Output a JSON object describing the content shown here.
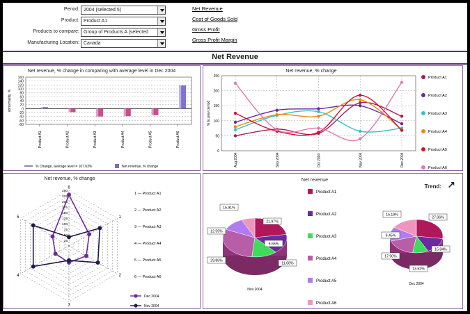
{
  "filters": [
    {
      "label": "Period:",
      "value": "2004 (selected 5)"
    },
    {
      "label": "Product:",
      "value": "Product A1"
    },
    {
      "label": "Products to compare:",
      "value": "Group of Products A (selected"
    },
    {
      "label": "Manufacturing Location:",
      "value": "Canada"
    }
  ],
  "links": [
    "Net Revenue",
    "Cost of Goods Sold",
    "Gross Profit",
    "Gross Profit Margin"
  ],
  "main_title": "Net Revenue",
  "colors": {
    "purple_dark": "#5b2d7a",
    "p1": "#b0185a",
    "p2": "#6a2aa0",
    "p3": "#2fc3c9",
    "p4": "#e78b12",
    "p5": "#d41030",
    "p6": "#e07ab0"
  },
  "chart_data": [
    {
      "type": "bar",
      "title": "Net revenue, % change in comparing with average level in Dec 2004",
      "ylabel": "abnormality, %",
      "categories": [
        "Product A1",
        "Product A2",
        "Product A3",
        "Product A4",
        "Product A5",
        "Product A6"
      ],
      "ylim": [
        -80,
        160
      ],
      "yticks": [
        160,
        140,
        120,
        100,
        80,
        60,
        40,
        20,
        0,
        -20,
        -40,
        -60,
        -80
      ],
      "values": [
        8,
        -18,
        -40,
        -38,
        -34,
        118
      ],
      "legend": [
        "% Change, average level = 107.63%",
        "Net revenue, % change"
      ]
    },
    {
      "type": "line",
      "title": "Net revenue, % change",
      "ylabel": "% to prev period",
      "x": [
        "Aug 2004",
        "Sep 2004",
        "Oct 2004",
        "Nov 2004",
        "Dec 2004"
      ],
      "ylim": [
        0,
        250
      ],
      "yticks": [
        0,
        50,
        100,
        150,
        200,
        250
      ],
      "series": [
        {
          "name": "Product A1",
          "values": [
            50,
            72,
            58,
            160,
            115
          ]
        },
        {
          "name": "Product A2",
          "values": [
            95,
            135,
            140,
            150,
            90
          ]
        },
        {
          "name": "Product A3",
          "values": [
            70,
            118,
            130,
            65,
            75
          ]
        },
        {
          "name": "Product A4",
          "values": [
            80,
            120,
            115,
            170,
            70
          ]
        },
        {
          "name": "Product A5",
          "values": [
            125,
            65,
            62,
            185,
            68
          ]
        },
        {
          "name": "Product A6",
          "values": [
            225,
            70,
            75,
            40,
            228
          ]
        }
      ]
    },
    {
      "type": "radar",
      "title": "Net revenue, % change",
      "axes": [
        "1",
        "2",
        "3",
        "4",
        "5",
        "6"
      ],
      "rticks": [
        250,
        225,
        200,
        175,
        150,
        125,
        100,
        75,
        50,
        25,
        0
      ],
      "axis_legend": [
        "1 — Product A1",
        "2 — Product A2",
        "3 — Product A3",
        "4 — Product A4",
        "5 — Product A5",
        "6 — Product A6"
      ],
      "series": [
        {
          "name": "Dec 2004",
          "values": [
            105,
            90,
            75,
            70,
            85,
            230
          ]
        },
        {
          "name": "Nov 2004",
          "values": [
            160,
            150,
            65,
            185,
            185,
            40
          ]
        }
      ]
    },
    {
      "type": "pie",
      "title": "Net revenue",
      "legend": [
        "Product A1",
        "Product A2",
        "Product A3",
        "Product A4",
        "Product A5",
        "Product A6"
      ],
      "trend_label": "Trend:",
      "pies": [
        {
          "name": "Nov 2004",
          "labels": [
            "21.97%",
            "15.91%",
            "12.59%",
            "29.86%",
            "11.08%",
            "6.65%"
          ]
        },
        {
          "name": "Dec 2004",
          "labels": [
            "27.06%",
            "15.19%",
            "9.45%",
            "17.90%",
            "13.52%",
            "15.84%"
          ]
        }
      ]
    }
  ]
}
